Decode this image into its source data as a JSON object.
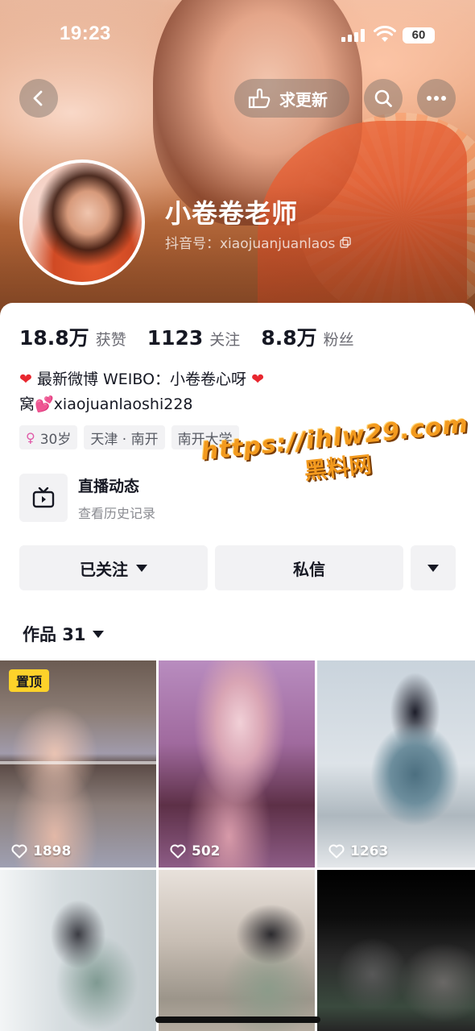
{
  "status_bar": {
    "time": "19:23",
    "battery": "60"
  },
  "header": {
    "request_update_label": "求更新"
  },
  "profile": {
    "name": "小卷卷老师",
    "douyin_id": "抖音号：xiaojuanjuanlaos"
  },
  "stats": [
    {
      "value": "18.8万",
      "label": "获赞"
    },
    {
      "value": "1123",
      "label": "关注"
    },
    {
      "value": "8.8万",
      "label": "粉丝"
    }
  ],
  "bio": {
    "line1": "最新微博 WEIBO：小卷卷心呀",
    "line2_prefix": "窝",
    "line2_text": "xiaojuanlaoshi228"
  },
  "tags": [
    {
      "text": "30岁",
      "icon": "female-icon"
    },
    {
      "text": "天津 · 南开"
    },
    {
      "text": "南开大学"
    }
  ],
  "live": {
    "title": "直播动态",
    "subtitle": "查看历史记录"
  },
  "watermark": {
    "url": "https://ihlw29.com",
    "text": "黑料网"
  },
  "actions": {
    "follow_label": "已关注",
    "message_label": "私信"
  },
  "works": {
    "label": "作品 31"
  },
  "videos": [
    {
      "likes": "1898",
      "pinned_label": "置顶"
    },
    {
      "likes": "502"
    },
    {
      "likes": "1263"
    },
    {
      "likes": ""
    },
    {
      "likes": ""
    },
    {
      "likes": ""
    }
  ],
  "colors": {
    "accent_pin": "#fdd22a",
    "heart": "#e8272f",
    "watermark": "#f39a1e"
  }
}
